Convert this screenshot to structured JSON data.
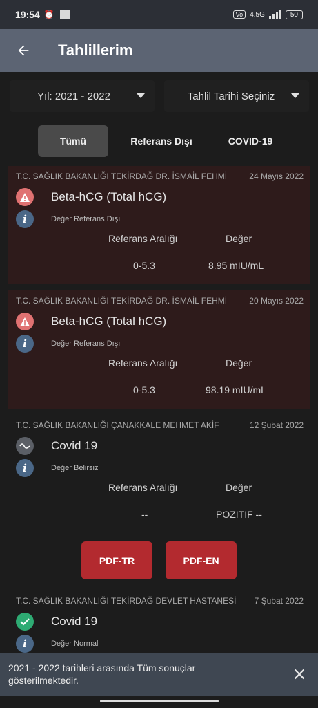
{
  "status_bar": {
    "time": "19:54",
    "network": "4.5G",
    "battery": "50"
  },
  "app_bar": {
    "title": "Tahlillerim"
  },
  "filters": {
    "year": "Yıl: 2021 - 2022",
    "date": "Tahlil Tarihi Seçiniz"
  },
  "tabs": [
    {
      "label": "Tümü"
    },
    {
      "label": "Referans Dışı"
    },
    {
      "label": "COVID-19"
    }
  ],
  "results": [
    {
      "hospital": "T.C. SAĞLIK BAKANLIĞI TEKİRDAĞ DR. İSMAİL FEHMİ",
      "date": "24 Mayıs 2022",
      "test": "Beta-hCG (Total hCG)",
      "status": "Değer Referans Dışı",
      "ref_label": "Referans Aralığı",
      "value_label": "Değer",
      "ref": "0-5.3",
      "value": "8.95 mIU/mL"
    },
    {
      "hospital": "T.C. SAĞLIK BAKANLIĞI TEKİRDAĞ DR. İSMAİL FEHMİ",
      "date": "20 Mayıs 2022",
      "test": "Beta-hCG (Total hCG)",
      "status": "Değer Referans Dışı",
      "ref_label": "Referans Aralığı",
      "value_label": "Değer",
      "ref": "0-5.3",
      "value": "98.19 mIU/mL"
    },
    {
      "hospital": "T.C. SAĞLIK BAKANLIĞI ÇANAKKALE MEHMET AKİF",
      "date": "12 Şubat 2022",
      "test": "Covid 19",
      "status": "Değer Belirsiz",
      "ref_label": "Referans Aralığı",
      "value_label": "Değer",
      "ref": "--",
      "value": "POZITIF --"
    },
    {
      "hospital": "T.C. SAĞLIK BAKANLIĞI TEKİRDAĞ DEVLET HASTANESİ",
      "date": "7 Şubat 2022",
      "test": "Covid 19",
      "status": "Değer Normal"
    }
  ],
  "pdf_buttons": {
    "tr": "PDF-TR",
    "en": "PDF-EN"
  },
  "snackbar": {
    "message": "2021 - 2022 tarihleri arasında Tüm sonuçlar gösterilmektedir."
  },
  "icons": {
    "back": "arrow-left-icon",
    "warning": "warning-icon",
    "info": "info-icon",
    "uncertain": "wave-icon",
    "normal": "check-icon",
    "close": "close-icon"
  },
  "colors": {
    "app_bar": "#5c6473",
    "abnormal_card": "#2e1b1b",
    "pdf_button": "#b32a2f",
    "warning": "#e07272",
    "normal": "#2eab73"
  }
}
